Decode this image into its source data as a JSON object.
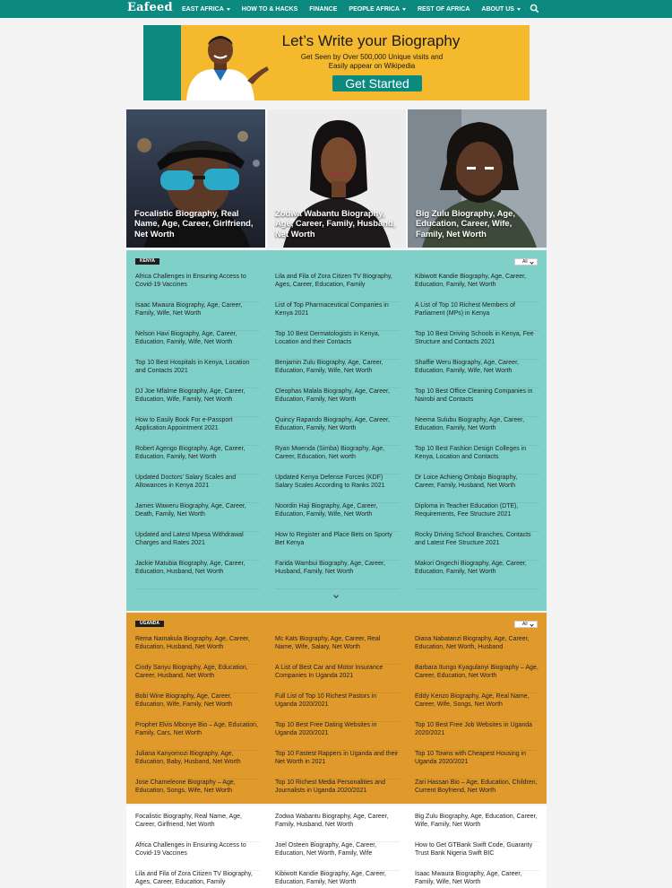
{
  "header": {
    "logo": "Eafeed",
    "nav": [
      {
        "label": "EAST AFRICA",
        "has_dropdown": true
      },
      {
        "label": "HOW TO & HACKS",
        "has_dropdown": false
      },
      {
        "label": "FINANCE",
        "has_dropdown": false
      },
      {
        "label": "PEOPLE AFRICA",
        "has_dropdown": true
      },
      {
        "label": "REST OF AFRICA",
        "has_dropdown": false
      },
      {
        "label": "ABOUT US",
        "has_dropdown": true
      }
    ],
    "search_icon": "search-icon"
  },
  "banner": {
    "title": "Let’s Write your Biography",
    "subtitle_line1": "Get Seen by Over 500,000 Unique visits and",
    "subtitle_line2": "Easily appear on Wikipedia",
    "button": "Get Started"
  },
  "featured": [
    {
      "title": "Focalistic Biography, Real Name, Age, Career, Girlfriend, Net Worth"
    },
    {
      "title": "Zodwa Wabantu Biography, Age, Career, Family, Husband, Net Worth"
    },
    {
      "title": "Big Zulu Biography, Age, Education, Career, Wife, Family, Net Worth"
    }
  ],
  "kenya": {
    "category": "KENYA",
    "filter": "All",
    "items": [
      "Africa Challenges in Ensuring Access to Covid-19 Vaccines",
      "Lila and Fila of Zora Citizen TV Biography, Ages, Career, Education, Family",
      "Kibiwott Kandie Biography, Age, Career, Education, Family, Net Worth",
      "Isaac Mwaura Biography, Age, Career, Family, Wife, Net Worth",
      "List of Top Pharmaceutical Companies in Kenya 2021",
      "A List of Top 10 Richest Members of Parliament (MPs) in Kenya",
      "Nelson Havi Biography, Age, Career, Education, Family, Wife, Net Worth",
      "Top 10 Best Dermatologists in Kenya, Location and their Contacts",
      "Top 10 Best Driving Schools in Kenya, Fee Structure and Contacts 2021",
      "Top 10 Best Hospitals in Kenya, Location and Contacts 2021",
      "Benjamin Zulu Biography, Age, Career, Education, Family, Wife, Net Worth",
      "Shaffie Weru Biography, Age, Career, Education, Family, Wife, Net Worth",
      "DJ Joe Mfalme Biography, Age, Career, Education, Wife, Family, Net Worth",
      "Cleophas Malala Biography, Age, Career, Education, Family, Net Worth",
      "Top 10 Best Office Cleaning Companies in Nairobi and Contacts",
      "How to Easily Book For e-Passport Application Appointment 2021",
      "Quincy Rapando Biography, Age, Career, Education, Family, Net Worth",
      "Neema Sulubu Biography, Age, Career, Education, Family, Net Worth",
      "Robert Agengo Biography, Age, Career, Education, Family, Net Worth",
      "Ryan Mwenda (Simba) Biography, Age, Career, Education, Net worth",
      "Top 10 Best Fashion Design Colleges in Kenya, Location and Contacts",
      "Updated Doctors’ Salary Scales and Allowances in Kenya 2021",
      "Updated Kenya Defense Forces (KDF) Salary Scales According to Ranks 2021",
      "Dr Loice Achieng Ombajo Biography, Career, Family, Husband, Net Worth",
      "James Waweru Biography, Age, Career, Death, Family, Net Worth",
      "Noordin Haji Biography, Age, Career, Education, Family, Wife, Net Worth",
      "Diploma in Teacher Education (DTE), Requirements, Fee Structure 2021",
      "Updated and Latest Mpesa Withdrawal Charges and Rates 2021",
      "How to Register and Place Bets on Sporty Bet Kenya",
      "Rocky Driving School Branches, Contacts and Latest Fee Structure 2021",
      "Jackie Matubia Biography, Age, Career, Education, Husband, Net Worth",
      "Farida Wambui Biography, Age, Career, Husband, Family, Net Worth",
      "Makori Ongechi Biography, Age, Career, Education, Family, Net Worth"
    ]
  },
  "uganda": {
    "category": "UGANDA",
    "filter": "All",
    "items": [
      "Rema Namakula Biography, Age, Career, Education, Husband, Net Worth",
      "Mc Kats Biography, Age, Career, Real Name, Wife, Salary, Net Worth",
      "Diana Nabatanzi Biography, Age, Career, Education, Net Worth, Husband",
      "Cindy Sanyu Biography, Age, Education, Career, Husband, Net Worth",
      "A List of Best Car and Motor Insurance Companies In Uganda 2021",
      "Barbara Itungo Kyagulanyi Biography – Age, Career, Education, Net Worth",
      "Bobi Wine Biography, Age, Career, Education, Wife, Family, Net Worth",
      "Full List of Top 10 Richest Pastors in Uganda 2020/2021",
      "Eddy Kenzo Biography, Age, Real Name, Career, Wife, Songs, Net Worth",
      "Prophet Elvis Mbonye Bio – Age, Education, Family, Cars, Net Worth",
      "Top 10 Best Free Dating Websites in Uganda 2020/2021",
      "Top 10 Best Free Job Websites in Uganda 2020/2021",
      "Juliana Kanyomozi Biography, Age, Education, Baby, Husband, Net Worth",
      "Top 10 Fastest Rappers in Uganda and their Net Worth in 2021",
      "Top 10 Towns with Cheapest Housing in Uganda 2020/2021",
      "Jose Chameleone Biography – Age, Education, Songs, Wife, Net Worth",
      "Top 10 Richest Media Personalities and Journalists in Uganda 2020/2021",
      "Zari Hassan Bio – Age, Education, Children, Current Boyfriend, Net Worth"
    ]
  },
  "latest": {
    "items": [
      "Focalistic Biography, Real Name, Age, Career, Girlfriend, Net Worth",
      "Zodwa Wabantu Biography, Age, Career, Family, Husband, Net Worth",
      "Big Zulu Biography, Age, Education, Career, Wife, Family, Net Worth",
      "Africa Challenges in Ensuring Access to Covid-19 Vaccines",
      "Joel Osteen Biography, Age, Career, Education, Net Worth, Family, Wife",
      "How to Get GTBank Swift Code, Guaranty Trust Bank Nigeria Swift BIC",
      "Lila and Fila of Zora Citizen TV Biography, Ages, Career, Education, Family",
      "Kibiwott Kandie Biography, Age, Career, Education, Family, Net Worth",
      "Isaac Mwaura Biography, Age, Career, Family, Wife, Net Worth"
    ]
  },
  "colors": {
    "brand_teal": "#0c8a7f",
    "kenya_bg": "#7fd0c8",
    "uganda_bg": "#e09a2b",
    "banner_yellow": "#f4b92d"
  }
}
